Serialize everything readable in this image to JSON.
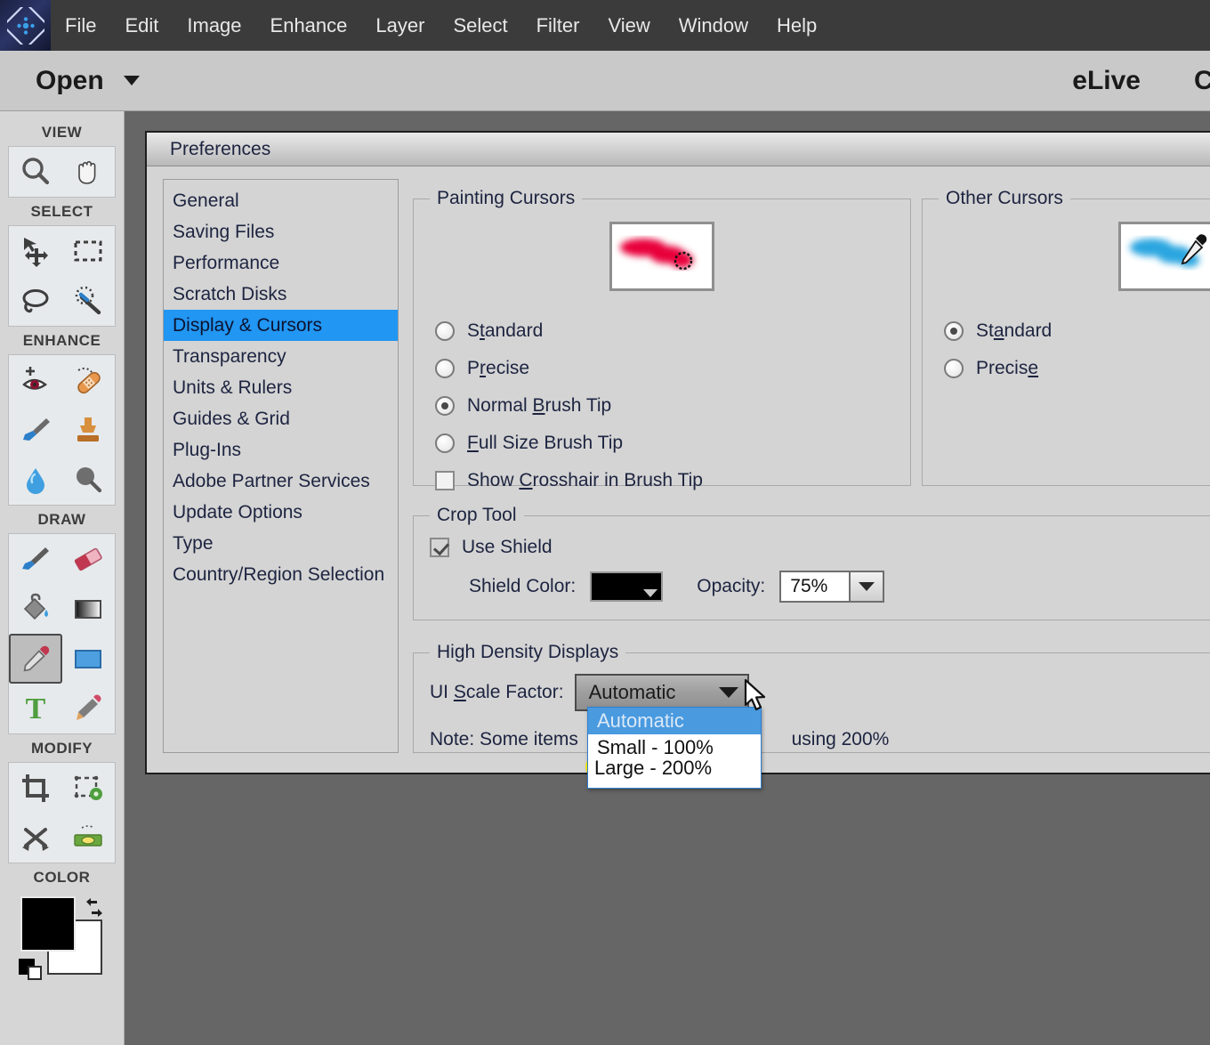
{
  "app": {
    "logo_icon": "photoshop-elements-diamond-icon"
  },
  "menubar": {
    "items": [
      {
        "label": "File"
      },
      {
        "label": "Edit"
      },
      {
        "label": "Image"
      },
      {
        "label": "Enhance"
      },
      {
        "label": "Layer"
      },
      {
        "label": "Select"
      },
      {
        "label": "Filter"
      },
      {
        "label": "View"
      },
      {
        "label": "Window"
      },
      {
        "label": "Help"
      }
    ]
  },
  "optionbar": {
    "open_label": "Open",
    "elive_label": "eLive",
    "create_label": "Create"
  },
  "toolbox": {
    "sections": [
      {
        "label": "VIEW",
        "tools": [
          {
            "name": "zoom-tool",
            "icon": "magnifier-icon"
          },
          {
            "name": "hand-tool",
            "icon": "hand-icon"
          }
        ]
      },
      {
        "label": "SELECT",
        "tools": [
          {
            "name": "move-tool",
            "icon": "move-arrows-icon"
          },
          {
            "name": "rectangular-marquee-tool",
            "icon": "dashed-rectangle-icon"
          },
          {
            "name": "lasso-tool",
            "icon": "lasso-icon"
          },
          {
            "name": "quick-selection-tool",
            "icon": "magic-wand-icon"
          }
        ]
      },
      {
        "label": "ENHANCE",
        "tools": [
          {
            "name": "red-eye-removal-tool",
            "icon": "eye-plus-icon"
          },
          {
            "name": "spot-healing-brush-tool",
            "icon": "bandage-icon"
          },
          {
            "name": "smart-brush-tool",
            "icon": "paint-brush-blue-icon"
          },
          {
            "name": "clone-stamp-tool",
            "icon": "stamp-icon"
          },
          {
            "name": "blur-tool",
            "icon": "water-drop-icon"
          },
          {
            "name": "sponge-tool",
            "icon": "sponge-icon"
          }
        ]
      },
      {
        "label": "DRAW",
        "tools": [
          {
            "name": "brush-tool",
            "icon": "brush-icon"
          },
          {
            "name": "eraser-tool",
            "icon": "eraser-icon"
          },
          {
            "name": "paint-bucket-tool",
            "icon": "paint-bucket-icon"
          },
          {
            "name": "gradient-tool",
            "icon": "gradient-icon"
          },
          {
            "name": "eyedropper-tool",
            "icon": "eyedropper-icon",
            "selected": true
          },
          {
            "name": "shape-tool",
            "icon": "blue-rectangle-icon"
          },
          {
            "name": "type-tool",
            "icon": "letter-t-icon"
          },
          {
            "name": "pencil-tool",
            "icon": "pencil-icon"
          }
        ]
      },
      {
        "label": "MODIFY",
        "tools": [
          {
            "name": "crop-tool",
            "icon": "crop-icon"
          },
          {
            "name": "recompose-tool",
            "icon": "recompose-icon"
          },
          {
            "name": "content-aware-move-tool",
            "icon": "crossed-arrows-icon"
          },
          {
            "name": "straighten-tool",
            "icon": "level-icon"
          }
        ]
      },
      {
        "label": "COLOR",
        "tools": []
      }
    ],
    "color": {
      "foreground": "#000000",
      "background": "#ffffff",
      "swap_icon": "swap-colors-icon",
      "default_icon": "default-colors-icon"
    }
  },
  "dialog": {
    "title": "Preferences",
    "categories": [
      {
        "label": "General",
        "active": false
      },
      {
        "label": "Saving Files",
        "active": false
      },
      {
        "label": "Performance",
        "active": false
      },
      {
        "label": "Scratch Disks",
        "active": false
      },
      {
        "label": "Display & Cursors",
        "active": true
      },
      {
        "label": "Transparency",
        "active": false
      },
      {
        "label": "Units & Rulers",
        "active": false
      },
      {
        "label": "Guides & Grid",
        "active": false
      },
      {
        "label": "Plug-Ins",
        "active": false
      },
      {
        "label": "Adobe Partner Services",
        "active": false
      },
      {
        "label": "Update Options",
        "active": false
      },
      {
        "label": "Type",
        "active": false
      },
      {
        "label": "Country/Region Selection",
        "active": false
      }
    ],
    "painting_cursors": {
      "legend": "Painting Cursors",
      "preview_icon": "red-brush-stroke-preview",
      "options": [
        {
          "label": "Standard",
          "mnemonic_index": 1,
          "checked": false
        },
        {
          "label": "Precise",
          "mnemonic_index": 1,
          "checked": false
        },
        {
          "label": "Normal Brush Tip",
          "mnemonic_index": 7,
          "checked": true
        },
        {
          "label": "Full Size Brush Tip",
          "mnemonic_index": 0,
          "checked": false
        }
      ],
      "crosshair": {
        "label": "Show Crosshair in Brush Tip",
        "mnemonic_index": 5,
        "checked": false
      }
    },
    "other_cursors": {
      "legend": "Other Cursors",
      "preview_icon": "blue-eyedropper-preview",
      "options": [
        {
          "label": "Standard",
          "mnemonic_index": 2,
          "checked": true
        },
        {
          "label": "Precise",
          "mnemonic_index": 6,
          "checked": false
        }
      ]
    },
    "crop_tool": {
      "legend": "Crop Tool",
      "use_shield": {
        "label": "Use Shield",
        "checked": true
      },
      "shield_color_label": "Shield Color:",
      "shield_color_value": "#000000",
      "opacity_label": "Opacity:",
      "opacity_value": "75%"
    },
    "high_density": {
      "legend": "High Density Displays",
      "ui_scale_label": "UI Scale Factor:",
      "ui_scale_mnemonic_index": 3,
      "ui_scale_value": "Automatic",
      "note_prefix": "Note: Some items",
      "note_suffix": "using 200%",
      "dropdown_open": true,
      "dropdown_items": [
        {
          "label": "Automatic",
          "highlighted": true,
          "marked": false
        },
        {
          "label": "Small - 100%",
          "highlighted": false,
          "marked": false
        },
        {
          "label": "Large - 200%",
          "highlighted": false,
          "marked": true
        }
      ],
      "marker_color": "#fff200"
    }
  }
}
